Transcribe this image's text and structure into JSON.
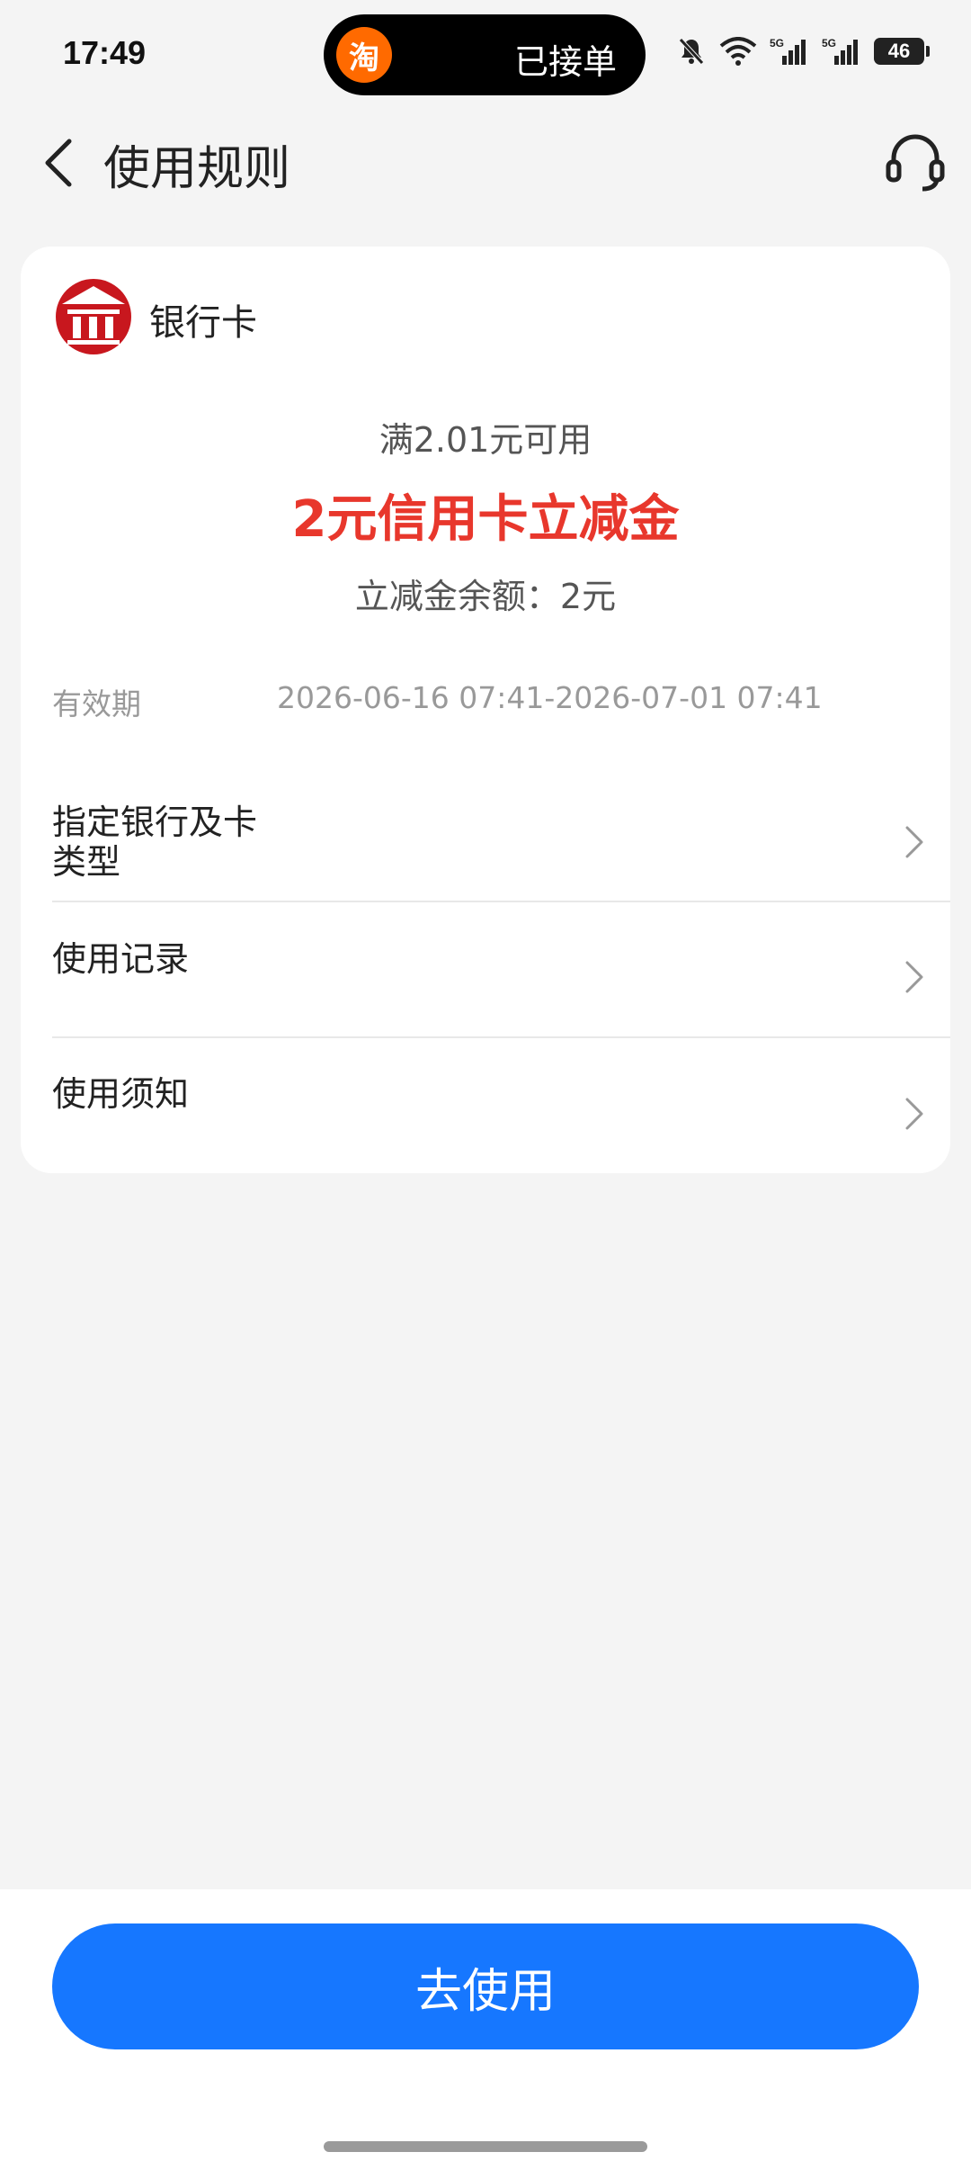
{
  "status_bar": {
    "time": "17:49",
    "island_app_glyph": "淘",
    "island_text": "已接单",
    "battery": "46",
    "network_labels": [
      "5G",
      "5G"
    ]
  },
  "header": {
    "title": "使用规则",
    "back_icon": "chevron-left-icon",
    "service_icon": "headset-icon"
  },
  "card": {
    "bank_name": "银行卡",
    "threshold": "满2.01元可用",
    "coupon_title": "2元信用卡立减金",
    "balance": "立减金余额：2元",
    "validity_label": "有效期",
    "validity_value": "2026-06-16 07:41-2026-07-01 07:41",
    "rows": [
      {
        "label_line1": "指定银行及卡",
        "label_line2": "类型"
      },
      {
        "label": "使用记录"
      },
      {
        "label": "使用须知"
      }
    ]
  },
  "colors": {
    "accent": "#1677ff",
    "coupon_red": "#e8372c",
    "bank_logo_red": "#c8171e"
  },
  "bottom": {
    "use_button_label": "去使用"
  }
}
